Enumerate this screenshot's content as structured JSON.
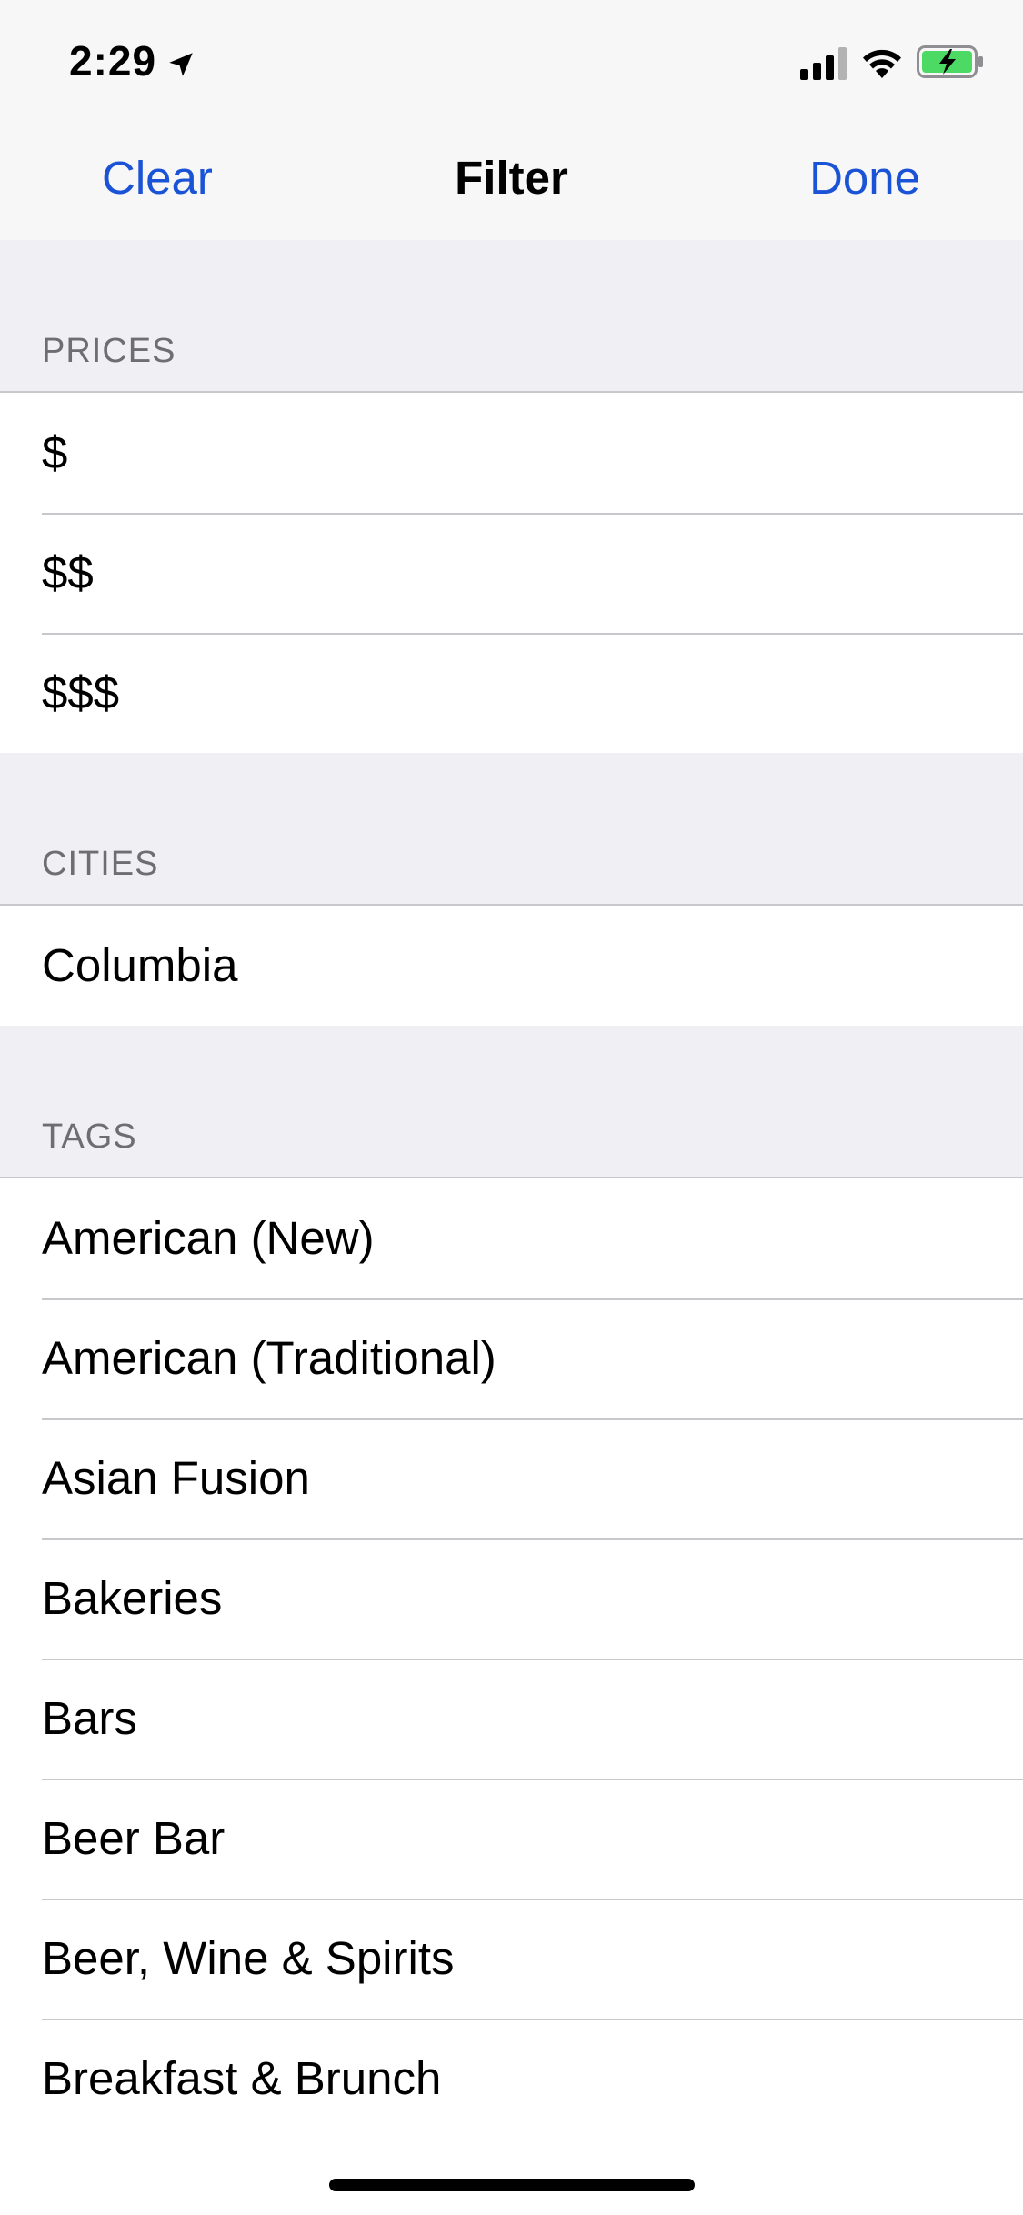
{
  "status_bar": {
    "time": "2:29",
    "icons": [
      "location-arrow-icon",
      "cellular-signal-icon",
      "wifi-icon",
      "battery-charging-icon"
    ],
    "battery_color": "#4cd964"
  },
  "nav": {
    "left_label": "Clear",
    "title": "Filter",
    "right_label": "Done",
    "accent_color": "#1a53d6"
  },
  "sections": {
    "prices": {
      "header": "PRICES",
      "items": [
        "$",
        "$$",
        "$$$"
      ]
    },
    "cities": {
      "header": "CITIES",
      "items": [
        "Columbia"
      ]
    },
    "tags": {
      "header": "TAGS",
      "items": [
        "American (New)",
        "American (Traditional)",
        "Asian Fusion",
        "Bakeries",
        "Bars",
        "Beer Bar",
        "Beer, Wine & Spirits",
        "Breakfast & Brunch"
      ]
    }
  }
}
